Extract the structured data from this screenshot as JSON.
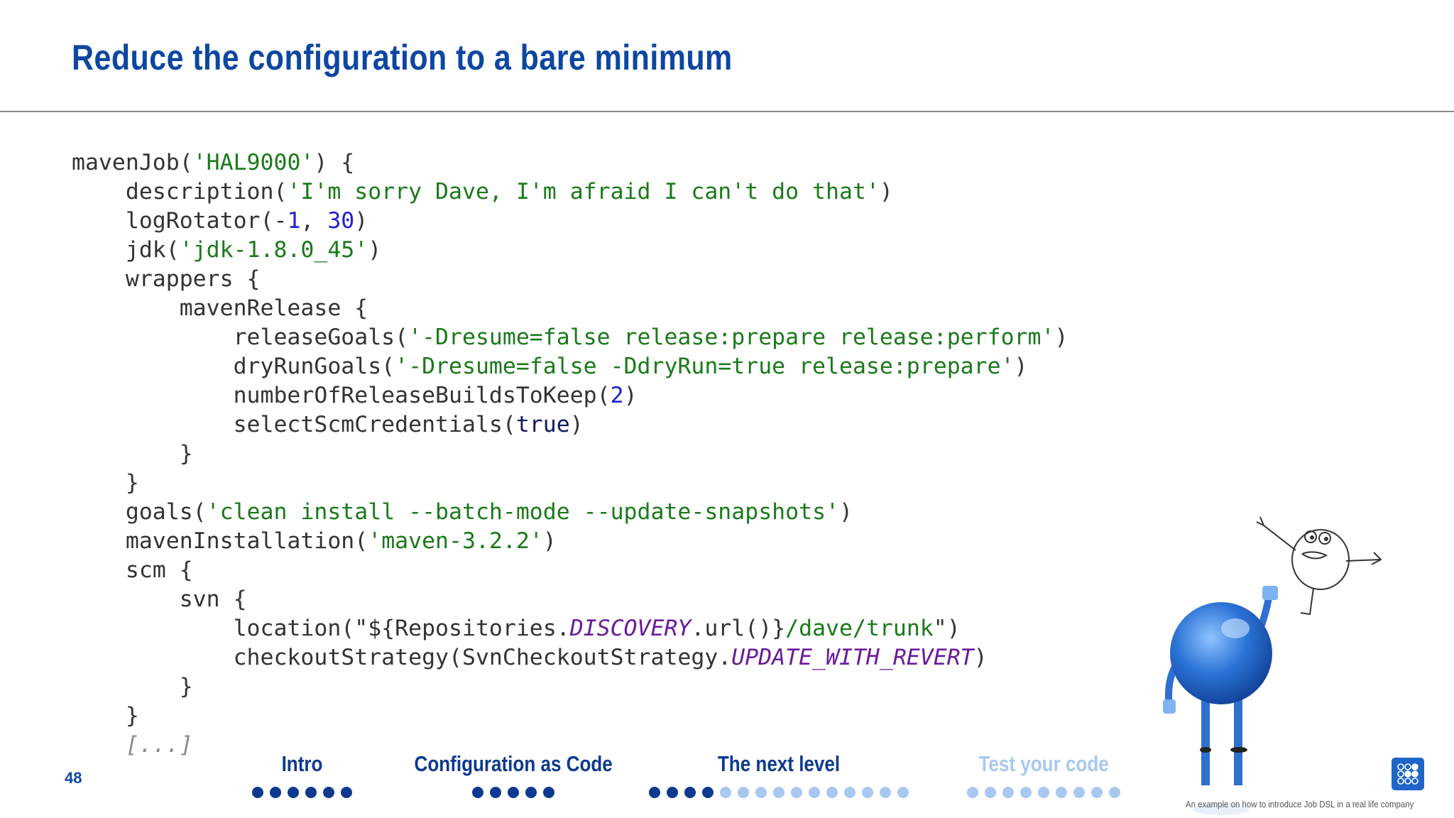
{
  "slide": {
    "title": "Reduce the configuration to a bare minimum",
    "page_number": "48",
    "footer": "An example on how to introduce Job DSL in a real life company"
  },
  "code_lines": [
    [
      {
        "t": "mavenJob("
      },
      {
        "t": "'HAL9000'",
        "c": "str"
      },
      {
        "t": ") {"
      }
    ],
    [
      {
        "t": "    description("
      },
      {
        "t": "'I'm sorry Dave, I'm afraid I can't do that'",
        "c": "str"
      },
      {
        "t": ")"
      }
    ],
    [
      {
        "t": "    logRotator(-"
      },
      {
        "t": "1",
        "c": "num"
      },
      {
        "t": ", "
      },
      {
        "t": "30",
        "c": "num"
      },
      {
        "t": ")"
      }
    ],
    [
      {
        "t": "    jdk("
      },
      {
        "t": "'jdk-1.8.0_45'",
        "c": "str"
      },
      {
        "t": ")"
      }
    ],
    [
      {
        "t": "    wrappers {"
      }
    ],
    [
      {
        "t": "        mavenRelease {"
      }
    ],
    [
      {
        "t": "            releaseGoals("
      },
      {
        "t": "'-Dresume=false release:prepare release:perform'",
        "c": "str"
      },
      {
        "t": ")"
      }
    ],
    [
      {
        "t": "            dryRunGoals("
      },
      {
        "t": "'-Dresume=false -DdryRun=true release:prepare'",
        "c": "str"
      },
      {
        "t": ")"
      }
    ],
    [
      {
        "t": "            numberOfReleaseBuildsToKeep("
      },
      {
        "t": "2",
        "c": "num"
      },
      {
        "t": ")"
      }
    ],
    [
      {
        "t": "            selectScmCredentials("
      },
      {
        "t": "true",
        "c": "kw"
      },
      {
        "t": ")"
      }
    ],
    [
      {
        "t": "        }"
      }
    ],
    [
      {
        "t": "    }"
      }
    ],
    [
      {
        "t": "    goals("
      },
      {
        "t": "'clean install --batch-mode --update-snapshots'",
        "c": "str"
      },
      {
        "t": ")"
      }
    ],
    [
      {
        "t": "    mavenInstallation("
      },
      {
        "t": "'maven-3.2.2'",
        "c": "str"
      },
      {
        "t": ")"
      }
    ],
    [
      {
        "t": "    scm {"
      }
    ],
    [
      {
        "t": "        svn {"
      }
    ],
    [
      {
        "t": "            location(\"${Repositories."
      },
      {
        "t": "DISCOVERY",
        "c": "it"
      },
      {
        "t": ".url()}"
      },
      {
        "t": "/dave/trunk",
        "c": "str"
      },
      {
        "t": "\")"
      }
    ],
    [
      {
        "t": "            checkoutStrategy(SvnCheckoutStrategy."
      },
      {
        "t": "UPDATE_WITH_REVERT",
        "c": "it"
      },
      {
        "t": ")"
      }
    ],
    [
      {
        "t": "        }"
      }
    ],
    [
      {
        "t": "    }"
      }
    ],
    [
      {
        "t": "    [...]",
        "c": "cm"
      }
    ]
  ],
  "nav": {
    "sections": [
      {
        "label": "Intro",
        "state": "active",
        "dots_on": 6,
        "dots_off": 0
      },
      {
        "label": "Configuration as Code",
        "state": "active",
        "dots_on": 5,
        "dots_off": 0
      },
      {
        "label": "The next level",
        "state": "active",
        "dots_on": 4,
        "dots_off": 11
      },
      {
        "label": "Test your code",
        "state": "dim",
        "dots_on": 0,
        "dots_off": 9
      }
    ]
  },
  "colors": {
    "brand_blue": "#0d47a1",
    "string_green": "#1a7a1a",
    "number_blue": "#1f1fd0",
    "italic_purple": "#6a1b9a",
    "dot_active": "#0d3a8f",
    "dot_inactive": "#a9c8ef"
  },
  "icons": {
    "logo": "company-logo-icon",
    "illustration": "mascot-illustration"
  }
}
